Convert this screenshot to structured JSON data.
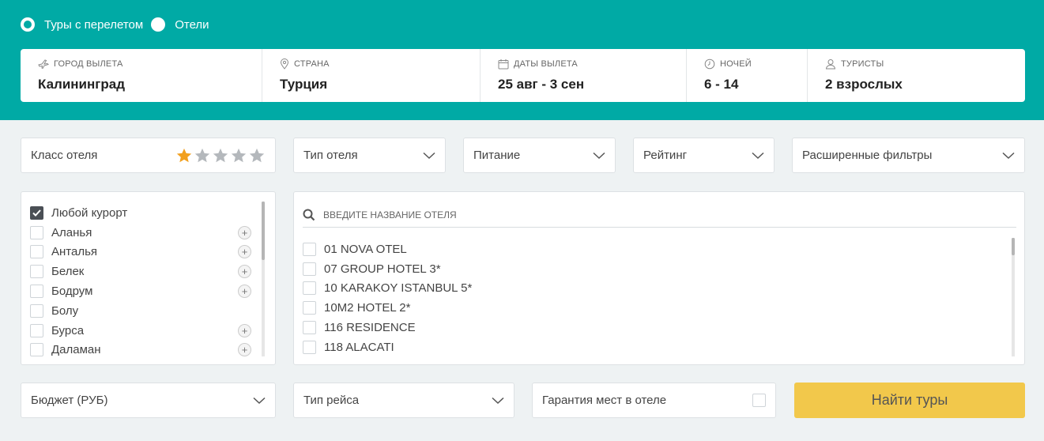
{
  "mode": {
    "options": [
      {
        "label": "Туры с перелетом",
        "selected": true
      },
      {
        "label": "Отели",
        "selected": false
      }
    ]
  },
  "search": {
    "city": {
      "label": "Город вылета",
      "value": "Калининград",
      "icon": "plane-icon"
    },
    "country": {
      "label": "Страна",
      "value": "Турция",
      "icon": "location-pin-icon"
    },
    "dates": {
      "label": "Даты вылета",
      "value": "25 авг - 3 сен",
      "icon": "calendar-icon"
    },
    "nights": {
      "label": "Ночей",
      "value": "6 - 14",
      "icon": "clock-icon"
    },
    "tourists": {
      "label": "Туристы",
      "value": "2 взрослых",
      "icon": "person-icon"
    }
  },
  "filters": {
    "hotel_class": {
      "label": "Класс отеля",
      "stars_total": 5,
      "stars_selected": 1
    },
    "hotel_type": "Тип отеля",
    "meal": "Питание",
    "rating": "Рейтинг",
    "advanced": "Расширенные фильтры"
  },
  "resorts": [
    {
      "name": "Любой курорт",
      "checked": true,
      "expandable": false
    },
    {
      "name": "Аланья",
      "checked": false,
      "expandable": true
    },
    {
      "name": "Анталья",
      "checked": false,
      "expandable": true
    },
    {
      "name": "Белек",
      "checked": false,
      "expandable": true
    },
    {
      "name": "Бодрум",
      "checked": false,
      "expandable": true
    },
    {
      "name": "Болу",
      "checked": false,
      "expandable": false
    },
    {
      "name": "Бурса",
      "checked": false,
      "expandable": true
    },
    {
      "name": "Даламан",
      "checked": false,
      "expandable": true
    }
  ],
  "hotel_search": {
    "placeholder": "Введите название отеля"
  },
  "hotels": [
    "01 NOVA OTEL",
    "07 GROUP HOTEL 3*",
    "10 KARAKOY ISTANBUL 5*",
    "10M2 HOTEL 2*",
    "116 RESIDENCE",
    "118 ALACATI"
  ],
  "bottom": {
    "budget": "Бюджет (РУБ)",
    "flight_type": "Тип рейса",
    "guarantee": "Гарантия мест в отеле",
    "submit": "Найти туры"
  },
  "colors": {
    "brand": "#00aaa5",
    "star_active": "#f2a01e",
    "star_inactive": "#b4b8bc",
    "submit": "#f2c84b"
  }
}
